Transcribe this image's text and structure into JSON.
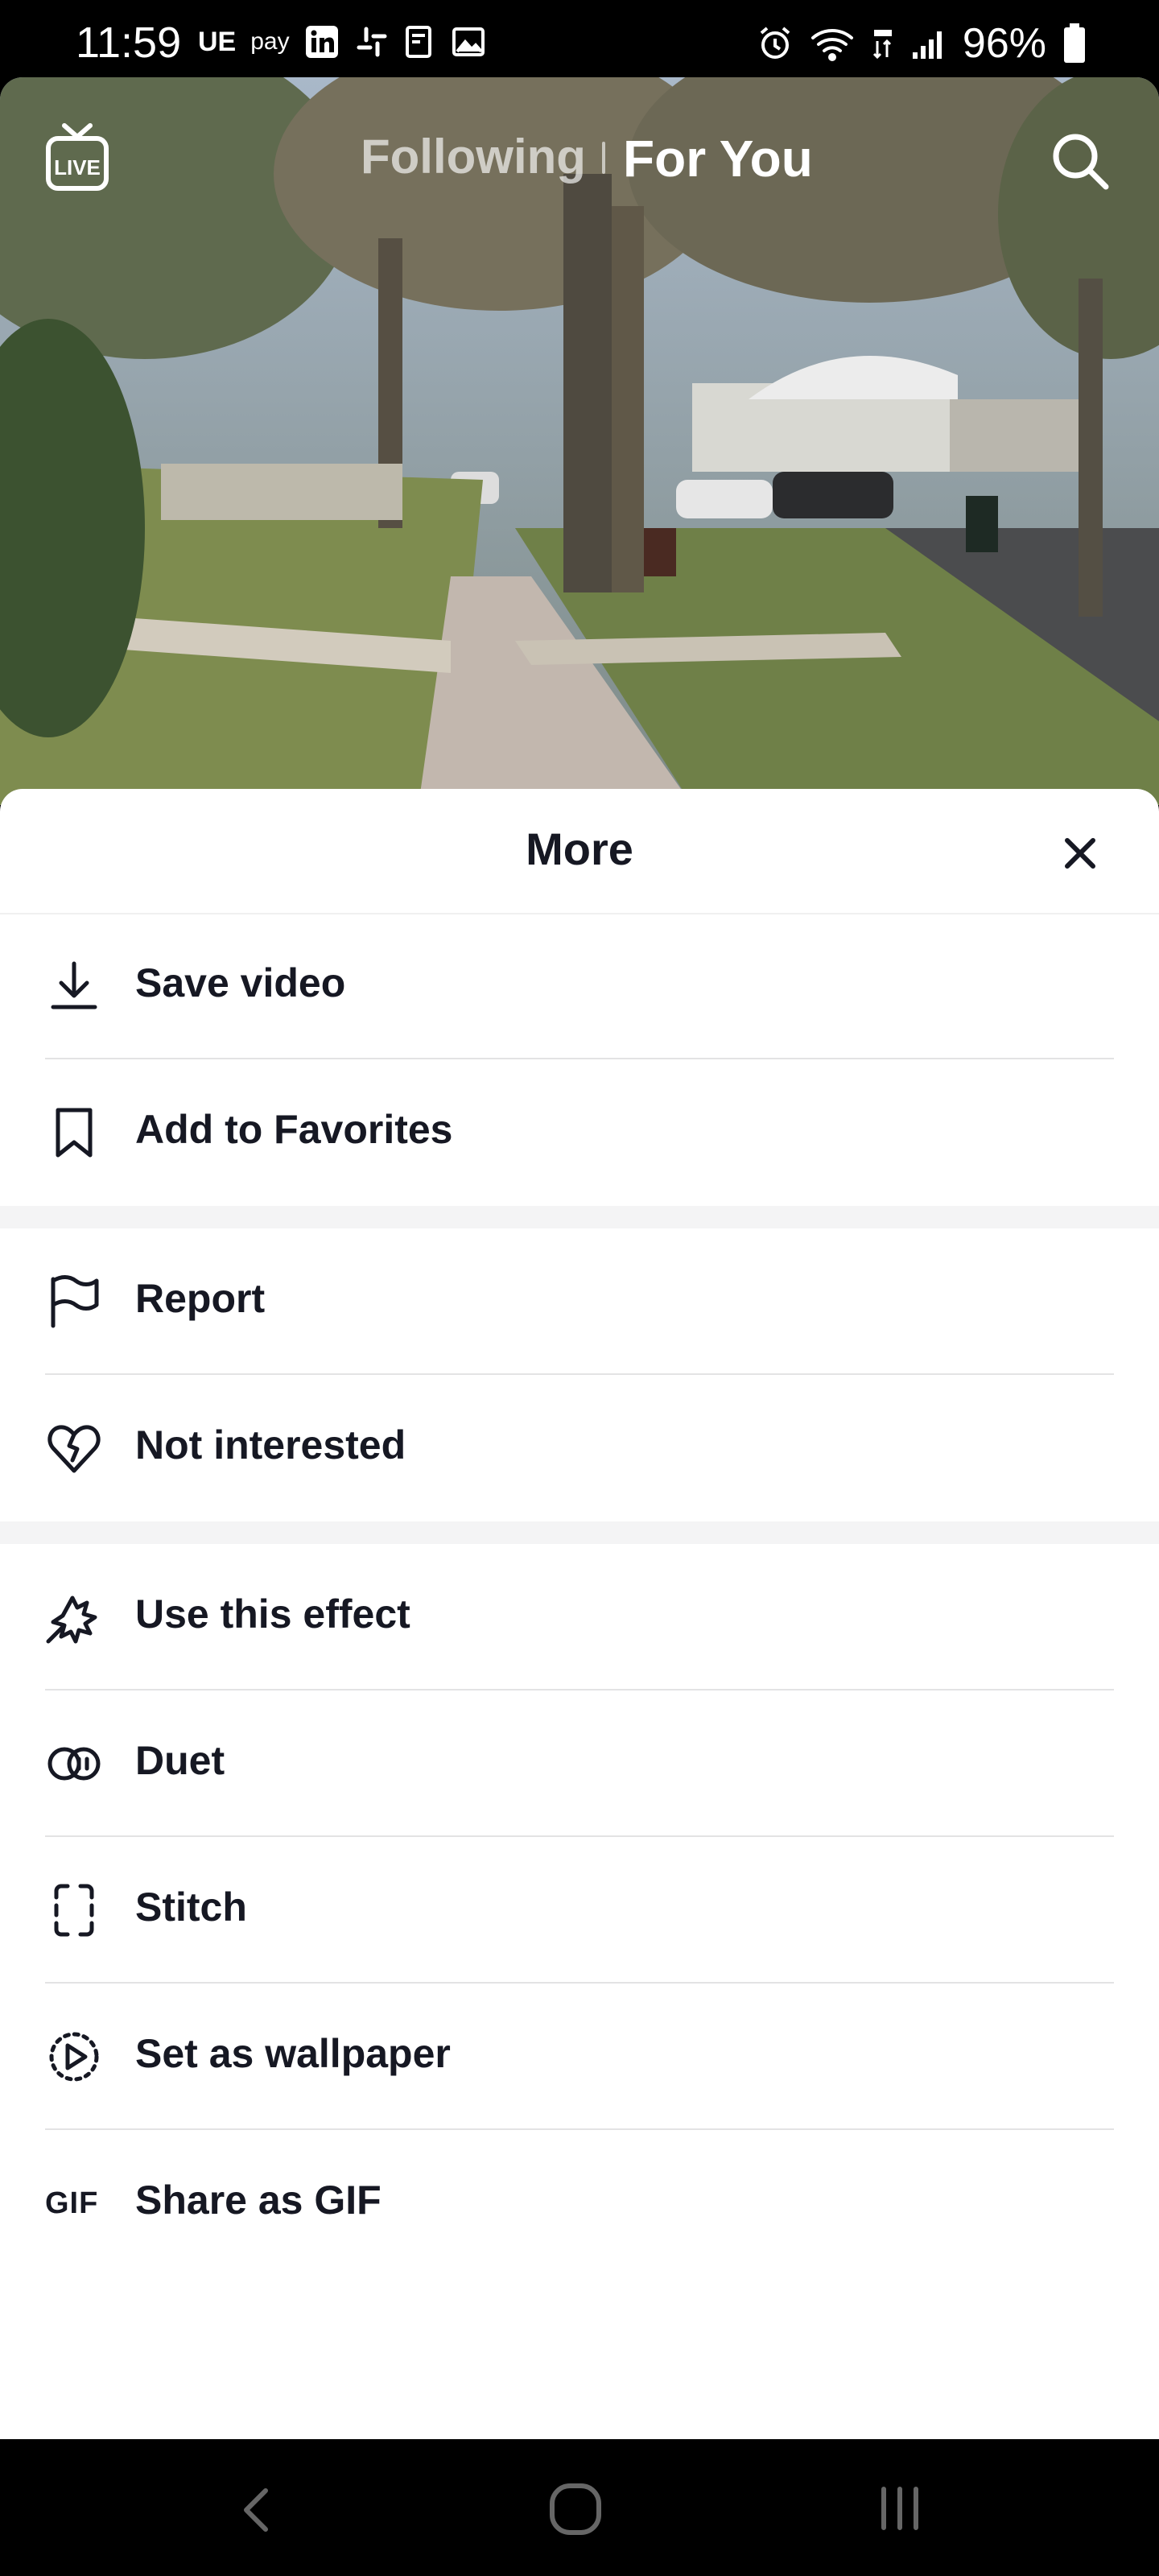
{
  "status_bar": {
    "time": "11:59",
    "left_icons": [
      "ue-icon",
      "samsung-pay-icon",
      "linkedin-icon",
      "slack-icon",
      "notes-icon",
      "gallery-icon"
    ],
    "ue_label": "UE",
    "pay_label": "pay",
    "battery": "96%"
  },
  "top_nav": {
    "following": "Following",
    "for_you": "For You"
  },
  "sheet": {
    "title": "More",
    "items": [
      {
        "label": "Save video",
        "icon": "download-icon"
      },
      {
        "label": "Add to Favorites",
        "icon": "bookmark-icon"
      },
      {
        "label": "Report",
        "icon": "flag-icon"
      },
      {
        "label": "Not interested",
        "icon": "broken-heart-icon"
      },
      {
        "label": "Use this effect",
        "icon": "effect-icon"
      },
      {
        "label": "Duet",
        "icon": "duet-icon"
      },
      {
        "label": "Stitch",
        "icon": "stitch-icon"
      },
      {
        "label": "Set as wallpaper",
        "icon": "wallpaper-icon"
      },
      {
        "label": "Share as GIF",
        "icon": "gif-icon",
        "icon_text": "GIF"
      }
    ]
  },
  "colors": {
    "text": "#161823",
    "divider": "#e3e3e4",
    "band": "#f4f4f5"
  }
}
